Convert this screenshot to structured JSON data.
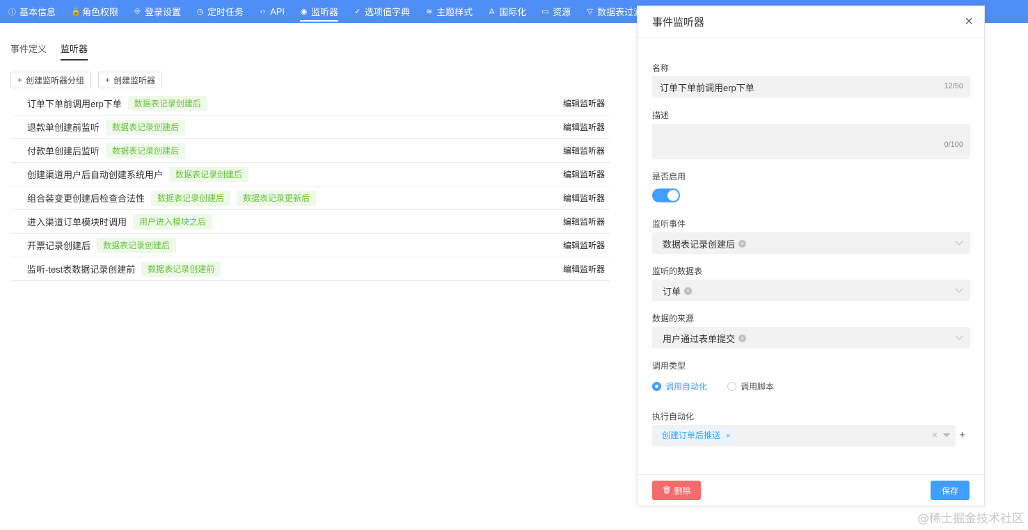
{
  "nav": {
    "items": [
      {
        "label": "基本信息",
        "icon": "info-circle-icon",
        "glyph": "ⓘ"
      },
      {
        "label": "角色权限",
        "icon": "lock-icon",
        "glyph": "🔒"
      },
      {
        "label": "登录设置",
        "icon": "login-icon",
        "glyph": "⎆"
      },
      {
        "label": "定时任务",
        "icon": "clock-icon",
        "glyph": "◷"
      },
      {
        "label": "API",
        "icon": "code-icon",
        "glyph": "‹›"
      },
      {
        "label": "监听器",
        "icon": "eye-icon",
        "glyph": "◉"
      },
      {
        "label": "选项值字典",
        "icon": "check-circle-icon",
        "glyph": "✓"
      },
      {
        "label": "主题样式",
        "icon": "theme-icon",
        "glyph": "≋"
      },
      {
        "label": "国际化",
        "icon": "translate-icon",
        "glyph": "A"
      },
      {
        "label": "资源",
        "icon": "file-icon",
        "glyph": "▭"
      },
      {
        "label": "数据表过滤器",
        "icon": "filter-icon",
        "glyph": "▽"
      }
    ],
    "active": "监听器"
  },
  "subtabs": [
    "事件定义",
    "监听器"
  ],
  "buttons": {
    "create_group": "创建监听器分组",
    "create_listener": "创建监听器",
    "plus": "+"
  },
  "listeners": [
    {
      "name": "订单下单前调用erp下单",
      "tags": [
        "数据表记录创建后"
      ],
      "edit": "编辑监听器"
    },
    {
      "name": "退款单创建前监听",
      "tags": [
        "数据表记录创建后"
      ],
      "edit": "编辑监听器"
    },
    {
      "name": "付款单创建后监听",
      "tags": [
        "数据表记录创建后"
      ],
      "edit": "编辑监听器"
    },
    {
      "name": "创建渠道用户后自动创建系统用户",
      "tags": [
        "数据表记录创建后"
      ],
      "edit": "编辑监听器"
    },
    {
      "name": "组合装变更创建后检查合法性",
      "tags": [
        "数据表记录创建后",
        "数据表记录更新后"
      ],
      "edit": "编辑监听器"
    },
    {
      "name": "进入渠道订单模块时调用",
      "tags": [
        "用户进入模块之后"
      ],
      "edit": "编辑监听器"
    },
    {
      "name": "开票记录创建后",
      "tags": [
        "数据表记录创建后"
      ],
      "edit": "编辑监听器"
    },
    {
      "name": "监听-test表数据记录创建前",
      "tags": [
        "数据表记录创建前"
      ],
      "edit": "编辑监听器"
    }
  ],
  "drawer": {
    "title": "事件监听器",
    "close": "×",
    "name_label": "名称",
    "name_value": "订单下单前调用erp下单",
    "name_count": "12/50",
    "desc_label": "描述",
    "desc_value": "",
    "desc_count": "0/100",
    "enabled_label": "是否启用",
    "enabled": true,
    "event_label": "监听事件",
    "event_value": "数据表记录创建后",
    "table_label": "监听的数据表",
    "table_value": "订单",
    "source_label": "数据的来源",
    "source_value": "用户通过表单提交",
    "call_type_label": "调用类型",
    "call_type_options": [
      "调用自动化",
      "调用脚本"
    ],
    "call_type_selected": "调用自动化",
    "automation_label": "执行自动化",
    "automation_value": "创建订单后推送",
    "tag_remove": "×",
    "clear": "×",
    "add": "+",
    "delete_label": "删除",
    "delete_icon": "🗑",
    "save_label": "保存"
  },
  "watermark": "@稀土掘金技术社区",
  "colors": {
    "primary": "#409eff",
    "nav": "#4f8ef7",
    "danger": "#f56c6c",
    "tag_green": "#67c23a"
  }
}
